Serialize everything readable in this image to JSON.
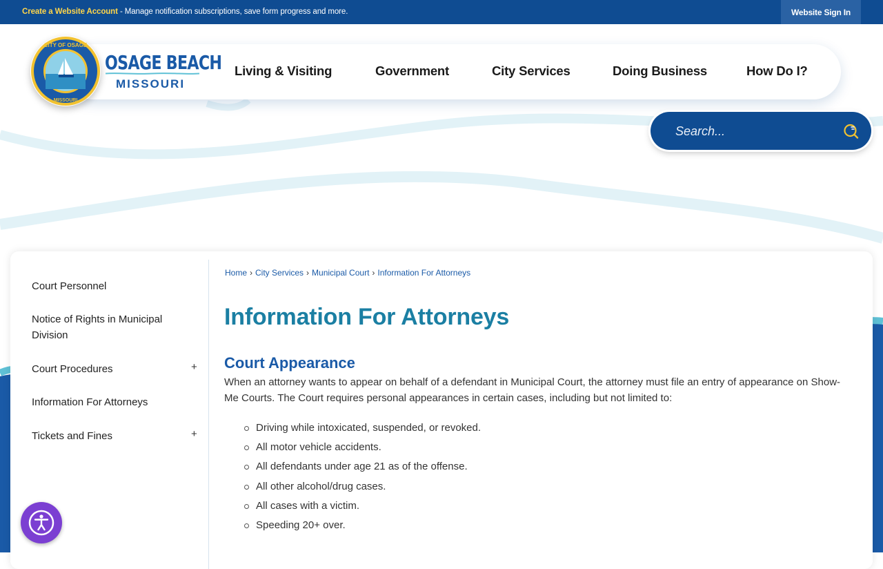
{
  "topbar": {
    "create_link": "Create a Website Account",
    "message": " - Manage notification subscriptions, save form progress and more.",
    "signin": "Website Sign In"
  },
  "brand": {
    "name": "OSAGE BEACH",
    "sub": "MISSOURI",
    "seal_text": "CITY OF OSAGE BEACH · MISSOURI"
  },
  "nav": {
    "items": [
      "Living & Visiting",
      "Government",
      "City Services",
      "Doing Business",
      "How Do I?"
    ]
  },
  "search": {
    "placeholder": "Search..."
  },
  "sidebar": {
    "items": [
      {
        "label": "Court Personnel"
      },
      {
        "label": "Notice of Rights in Municipal Division"
      },
      {
        "label": "Court Procedures",
        "expand": "+"
      },
      {
        "label": "Information For Attorneys"
      },
      {
        "label": "Tickets and Fines",
        "expand": "+"
      }
    ]
  },
  "breadcrumb": [
    "Home",
    "City Services",
    "Municipal Court",
    "Information For Attorneys"
  ],
  "breadcrumb_sep": "›",
  "page": {
    "title": "Information For Attorneys",
    "section_title": "Court Appearance",
    "intro": "When an attorney wants to appear on behalf of a defendant in Municipal Court, the attorney must file an entry of appearance on Show-Me Courts. The Court requires personal appearances in certain cases, including but not limited to:",
    "bullets": [
      "Driving while intoxicated, suspended, or revoked.",
      "All motor vehicle accidents.",
      "All defendants under age 21 as of the offense.",
      "All other alcohol/drug cases.",
      "All cases with a victim.",
      "Speeding 20+ over."
    ]
  },
  "accessibility": {
    "icon": "accessibility-icon"
  },
  "colors": {
    "primary": "#0f4c92",
    "accent": "#ffd54a",
    "title": "#1b7fa3",
    "link": "#1a5aa7",
    "a11y": "#7b3fd2"
  }
}
